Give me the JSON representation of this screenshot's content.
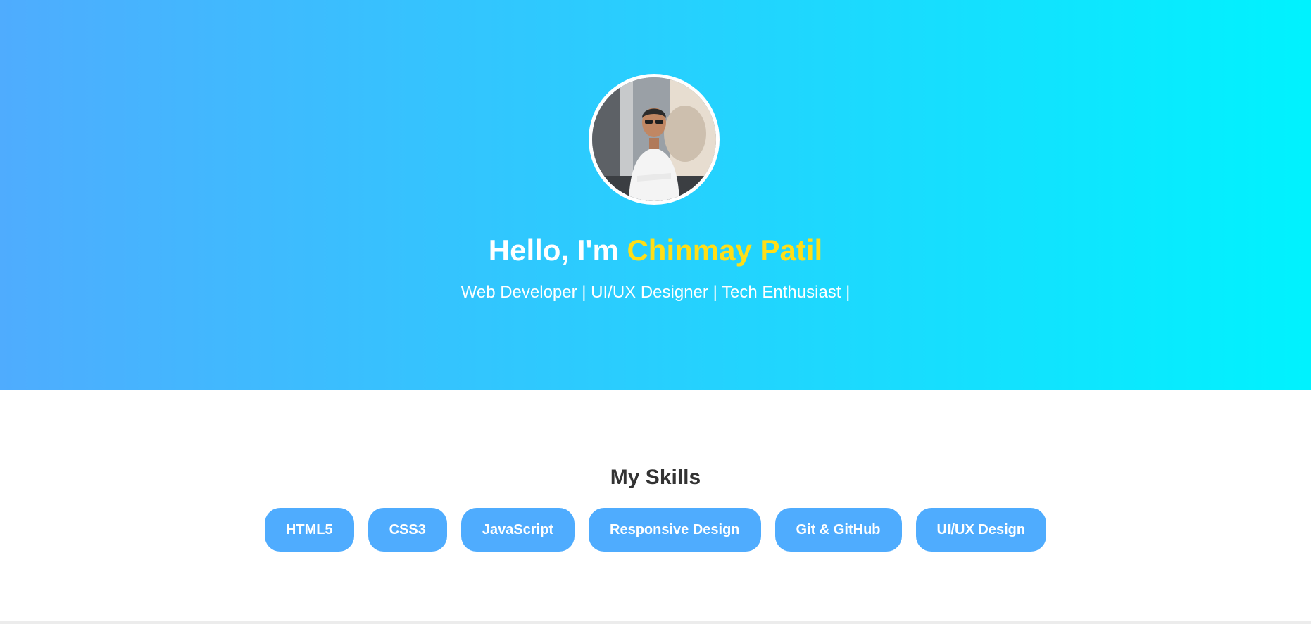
{
  "hero": {
    "greeting_prefix": "Hello, I'm ",
    "name": "Chinmay Patil",
    "tagline": "Web Developer | UI/UX Designer | Tech Enthusiast |",
    "gradient_start": "#4facfe",
    "gradient_end": "#00f2fe",
    "name_color": "#ffde17"
  },
  "skills": {
    "title": "My Skills",
    "items": [
      {
        "label": "HTML5"
      },
      {
        "label": "CSS3"
      },
      {
        "label": "JavaScript"
      },
      {
        "label": "Responsive Design"
      },
      {
        "label": "Git & GitHub"
      },
      {
        "label": "UI/UX Design"
      }
    ],
    "chip_color": "#4facfe"
  }
}
